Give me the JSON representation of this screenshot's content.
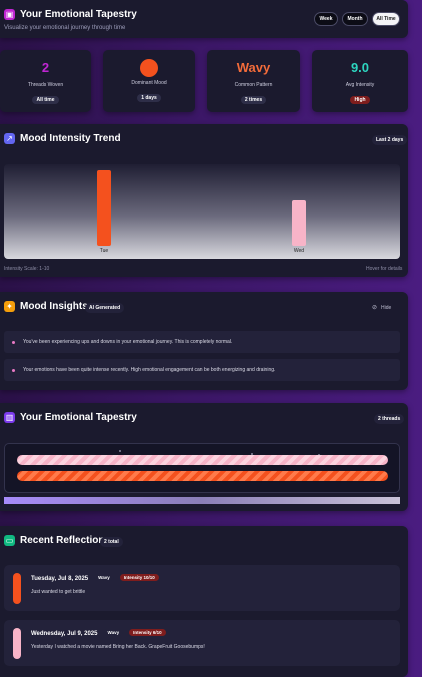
{
  "header": {
    "title": "Your Emotional Tapestry",
    "subtitle": "Visualize your emotional journey through time",
    "ranges": [
      "Week",
      "Month",
      "All Time"
    ],
    "active_range": "All Time"
  },
  "stats": [
    {
      "value": "2",
      "label": "Threads Woven",
      "badge": "All time",
      "color": "#c026d3"
    },
    {
      "value": "",
      "label": "Dominant Mood",
      "badge": "1 days",
      "color": "#f4511e"
    },
    {
      "value": "Wavy",
      "label": "Common Pattern",
      "badge": "2 times",
      "color": "#f26b3a"
    },
    {
      "value": "9.0",
      "label": "Avg Intensity",
      "badge": "High",
      "color": "#2dd4bf"
    }
  ],
  "trend": {
    "title": "Mood Intensity Trend",
    "badge": "Last 2 days",
    "scale_label": "Intensity Scale: 1-10",
    "hover_hint": "Hover for details"
  },
  "chart_data": {
    "type": "bar",
    "categories": [
      "Tue",
      "Wed"
    ],
    "values": [
      10,
      6
    ],
    "colors": [
      "#f4511e",
      "#f8b4c8"
    ],
    "ylim": [
      0,
      10
    ]
  },
  "insights": {
    "title": "Mood Insights",
    "badge": "AI Generated",
    "hide_label": "Hide",
    "items": [
      "You've been experiencing ups and downs in your emotional journey. This is completely normal.",
      "Your emotions have been quite intense recently. High emotional engagement can be both energizing and draining."
    ]
  },
  "tapestry": {
    "title": "Your Emotional Tapestry",
    "badge": "2 threads",
    "threads": [
      {
        "color": "#f8b4c8",
        "pattern": "Wavy"
      },
      {
        "color": "#f4511e",
        "pattern": "Wavy"
      }
    ]
  },
  "reflections": {
    "title": "Recent Reflections",
    "badge": "2 total",
    "entries": [
      {
        "date": "Tuesday, Jul 8, 2025",
        "pattern": "Wavy",
        "intensity": "Intensity 10/10",
        "text": "Just wanted to get brittle",
        "color": "#f4511e"
      },
      {
        "date": "Wednesday, Jul 9, 2025",
        "pattern": "Wavy",
        "intensity": "Intensity 6/10",
        "text": "Yesterday I watched a movie named Bring her Back. GrapeFruit Goosebumps!",
        "color": "#f8b4c8"
      }
    ]
  }
}
